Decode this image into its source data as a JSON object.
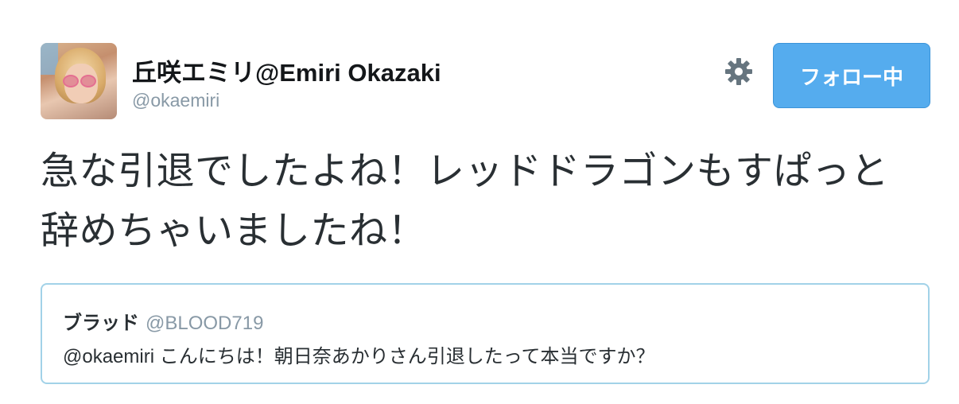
{
  "author": {
    "display_name": "丘咲エミリ@Emiri Okazaki",
    "screen_name": "@okaemiri",
    "avatar_icon": "avatar-photo"
  },
  "actions": {
    "settings_icon": "gear-icon",
    "follow_button_label": "フォロー中",
    "follow_button_color": "#55acee"
  },
  "tweet": {
    "text": "急な引退でしたよね！レッドドラゴンもすぱっと辞めちゃいましたね！"
  },
  "quoted_tweet": {
    "name": "ブラッド",
    "handle": "@BLOOD719",
    "text": "@okaemiri こんにちは！朝日奈あかりさん引退したって本当ですか？"
  },
  "colors": {
    "text_primary": "#292f33",
    "text_secondary": "#8899a6",
    "quote_border": "#a2d2e8"
  }
}
